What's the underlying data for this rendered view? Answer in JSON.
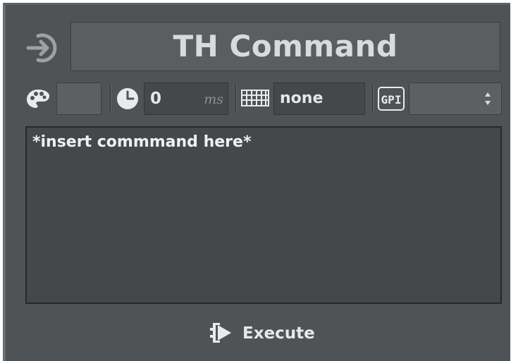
{
  "header": {
    "title": "TH Command",
    "title_icon": "input-arrow-icon"
  },
  "toolbar": {
    "color_icon": "palette-icon",
    "duration_icon": "clock-icon",
    "duration_value": "0",
    "duration_unit": "ms",
    "hotkey_icon": "keyboard-icon",
    "hotkey_value": "none",
    "gpi_icon": "gpi-icon",
    "gpi_label": "GPI",
    "gpi_selected": ""
  },
  "command": {
    "text": "*insert commmand here*"
  },
  "execute": {
    "label": "Execute",
    "icon": "execute-play-icon"
  },
  "colors": {
    "panel_bg": "#505356",
    "field_bg": "#45484a",
    "text": "#e6e6e6"
  }
}
